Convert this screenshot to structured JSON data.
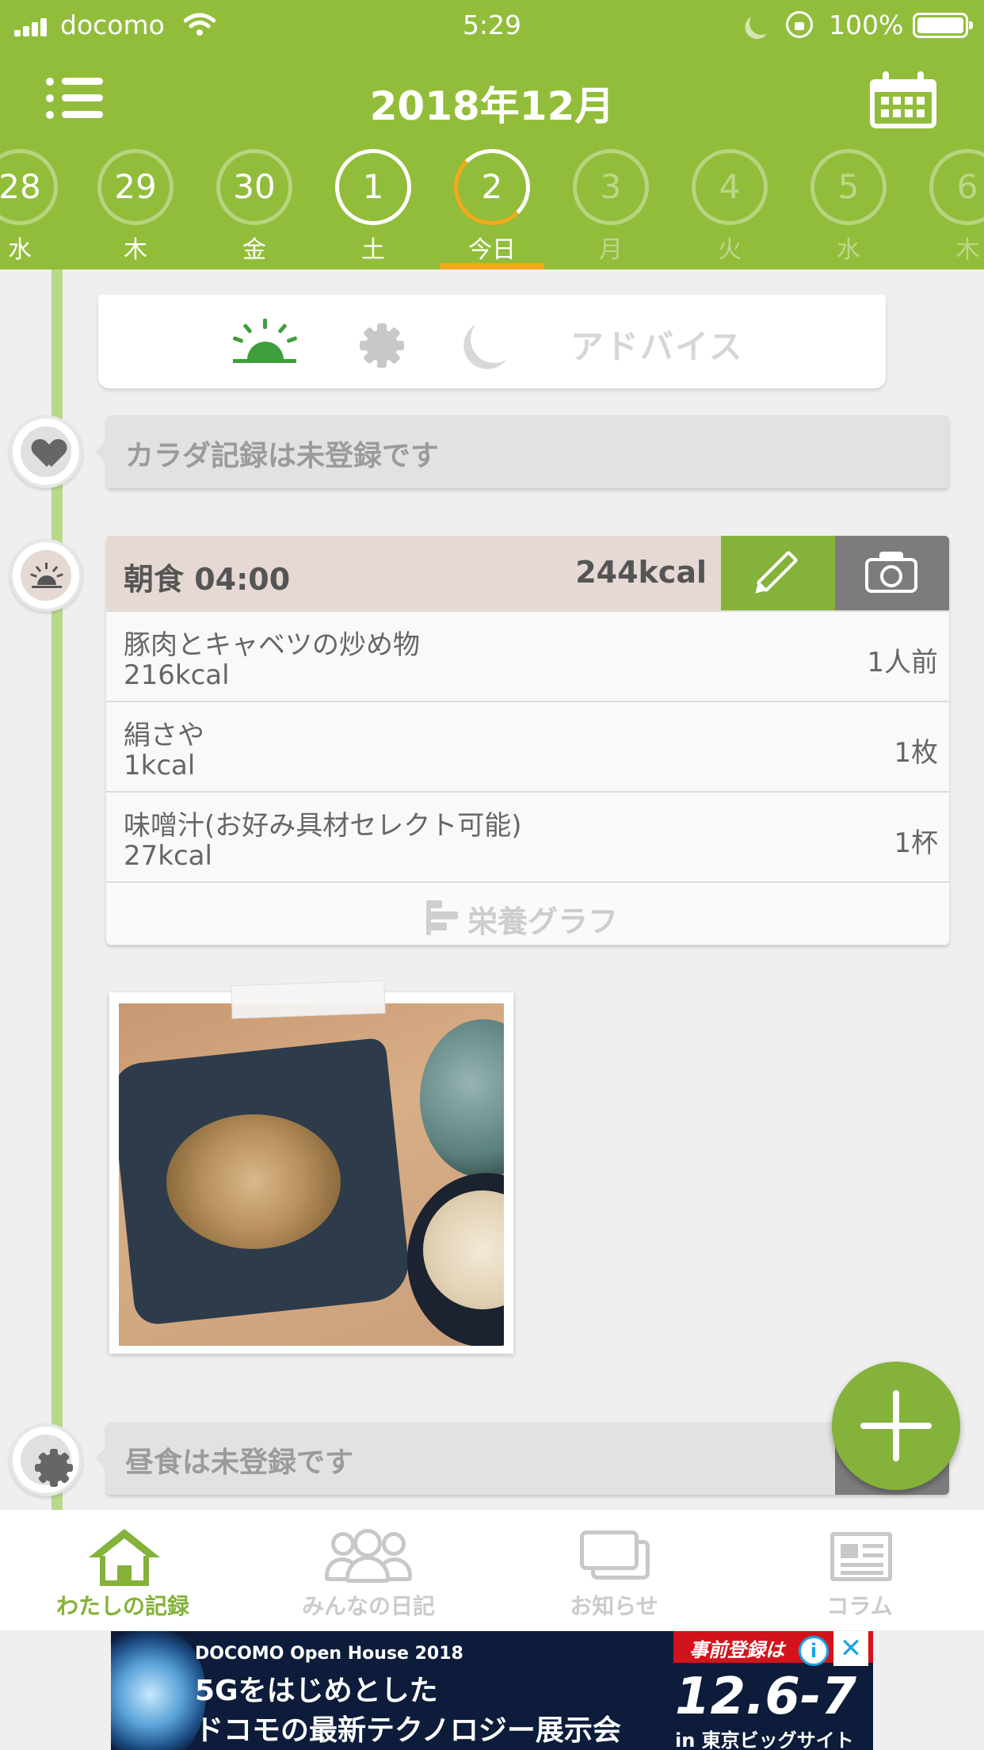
{
  "status_bar": {
    "carrier": "docomo",
    "time": "5:29",
    "battery_text": "100%"
  },
  "header": {
    "title": "2018年12月",
    "menu_icon": "list-icon",
    "calendar_icon": "calendar-icon",
    "background_color": "#92bd3b",
    "today_accent_color": "#f2a91a"
  },
  "dates": [
    {
      "day": "28",
      "weekday": "水"
    },
    {
      "day": "29",
      "weekday": "木"
    },
    {
      "day": "30",
      "weekday": "金"
    },
    {
      "day": "1",
      "weekday": "土"
    },
    {
      "day": "2",
      "weekday": "今日"
    },
    {
      "day": "3",
      "weekday": "月"
    },
    {
      "day": "4",
      "weekday": "火"
    },
    {
      "day": "5",
      "weekday": "水"
    },
    {
      "day": "6",
      "weekday": "木"
    }
  ],
  "advice": {
    "label": "アドバイス",
    "icons": [
      "sunrise-icon",
      "sun-icon",
      "moon-icon"
    ]
  },
  "body_record": {
    "text": "カラダ記録は未登録です"
  },
  "breakfast": {
    "title": "朝食 04:00",
    "total_kcal": "244kcal",
    "items": [
      {
        "name": "豚肉とキャベツの炒め物",
        "kcal": "216kcal",
        "qty": "1人前"
      },
      {
        "name": "絹さや",
        "kcal": "1kcal",
        "qty": "1枚"
      },
      {
        "name": "味噌汁(お好み具材セレクト可能)",
        "kcal": "27kcal",
        "qty": "1杯"
      }
    ],
    "graph_label": "栄養グラフ"
  },
  "lunch": {
    "text": "昼食は未登録です"
  },
  "tabs": [
    {
      "label": "わたしの記録",
      "icon": "home-icon",
      "active": true
    },
    {
      "label": "みんなの日記",
      "icon": "people-icon",
      "active": false
    },
    {
      "label": "お知らせ",
      "icon": "chat-icon",
      "active": false
    },
    {
      "label": "コラム",
      "icon": "news-icon",
      "active": false
    }
  ],
  "ad": {
    "line1": "DOCOMO Open House 2018",
    "line2": "5Gをはじめとした",
    "line3": "ドコモの最新テクノロジー展示会",
    "badge": "事前登録は",
    "date": "12.6-7",
    "location": "in 東京ビッグサイト",
    "info": "i",
    "close": "✕"
  }
}
